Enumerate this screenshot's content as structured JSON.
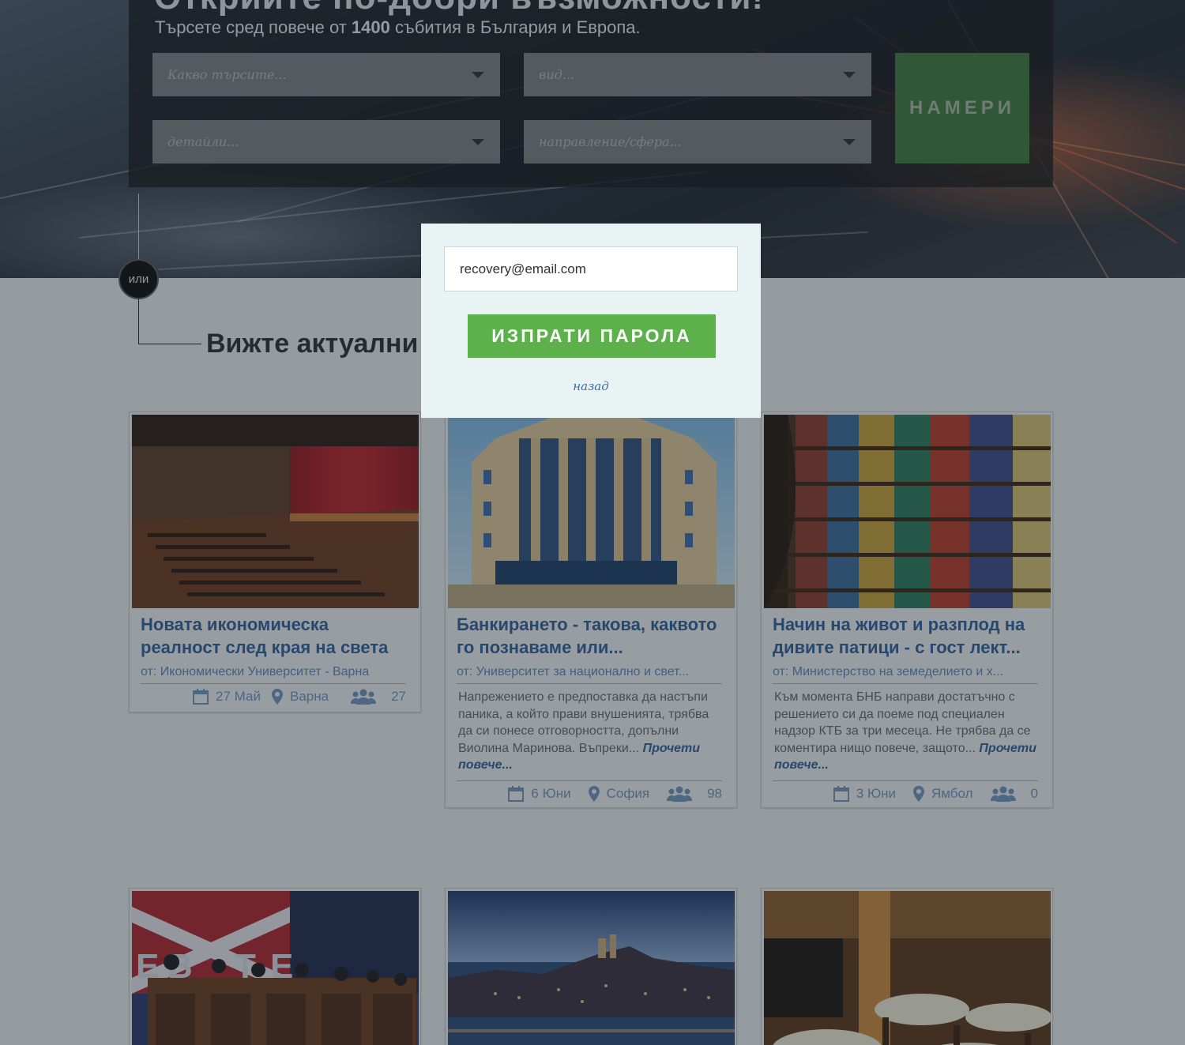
{
  "hero": {
    "title": "Открийте по-добри възможности!",
    "subtitle_pre": "Търсете сред повече от",
    "subtitle_count": "1400",
    "subtitle_post": "събития в България и Европа.",
    "filters": [
      {
        "placeholder": "Какво търсите..."
      },
      {
        "placeholder": "вид..."
      },
      {
        "placeholder": "детайли..."
      },
      {
        "placeholder": "направление/сфера..."
      }
    ],
    "find_button": "НАМЕРИ"
  },
  "connector": {
    "or_label": "или"
  },
  "section": {
    "title": "Вижте актуални"
  },
  "cards": [
    {
      "title": "Новата икономическа реалност след края на света",
      "org": "от: Икономически Университет - Варна",
      "description": "",
      "more": "",
      "date": "27 Май",
      "city": "Варна",
      "attendees": "27"
    },
    {
      "title": "Банкирането - такова, каквото го познаваме или...",
      "org": "от: Университет за национално и свет...",
      "description": "Напрежението е предпоставка да настъпи паника, а който прави внушенията, трябва да си понесе отговорността, допълни Виолина Маринова. Въпреки...",
      "more": "Прочети повече...",
      "date": "6 Юни",
      "city": "София",
      "attendees": "98"
    },
    {
      "title": "Начин на живот и разплод на дивите патици - с гост лект...",
      "org": "от: Министерство на земеделието и х...",
      "description": "Към момента БНБ направи достатъчно с решението си да поеме под специален надзор КТБ за три месеца. Не трябва да се коментира нищо повече, защото...",
      "more": "Прочети повече...",
      "date": "3 Юни",
      "city": "Ямбол",
      "attendees": "0"
    }
  ],
  "modal": {
    "email_value": "recovery@email.com",
    "send_button": "ИЗПРАТИ ПАРОЛА",
    "back_link": "назад"
  },
  "colors": {
    "accent_green": "#5cb14a",
    "link_blue": "#2f5d9a",
    "meta_blue": "#6e93c2"
  }
}
